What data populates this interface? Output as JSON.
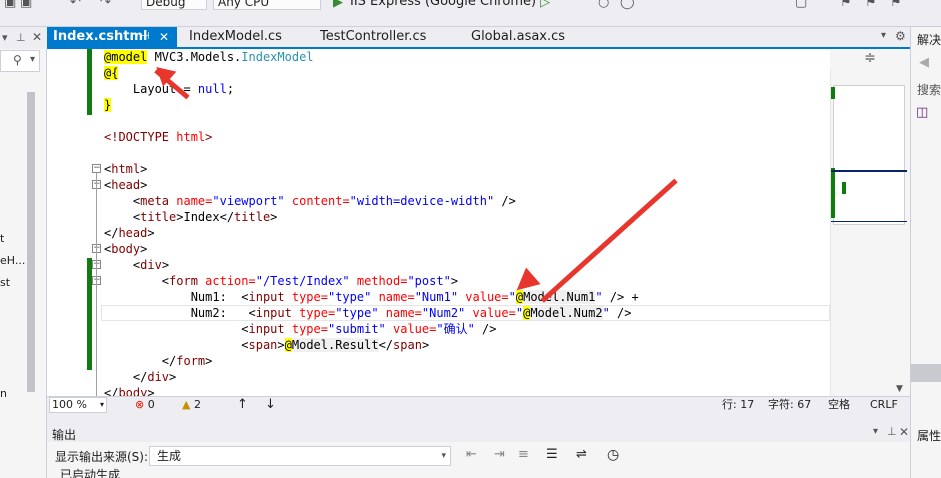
{
  "toolbar": {
    "config_value": "Debug",
    "platform_value": "Any CPU",
    "run_label": "IIS Express (Google Chrome)"
  },
  "left_panel": {
    "items": [
      "t",
      "eH...",
      "st",
      "n"
    ]
  },
  "tabs": [
    {
      "label": "Index.cshtml",
      "active": true
    },
    {
      "label": "IndexModel.cs",
      "active": false
    },
    {
      "label": "TestController.cs",
      "active": false
    },
    {
      "label": "Global.asax.cs",
      "active": false
    }
  ],
  "code": {
    "l1": {
      "a": "@model",
      "b": " MVC3.Models.",
      "c": "IndexModel"
    },
    "l2": "@{",
    "l3": {
      "a": "    Layout = ",
      "b": "null",
      "c": ";"
    },
    "l4": "}",
    "l5": {
      "a": "<!DOCTYPE ",
      "b": "html",
      "c": ">"
    },
    "l6": {
      "a": "<",
      "b": "html",
      "c": ">"
    },
    "l7": {
      "a": "<",
      "b": "head",
      "c": ">"
    },
    "l8": {
      "a": "    <",
      "b": "meta",
      "c": " name=",
      "d": "\"viewport\"",
      "e": " content=",
      "f": "\"width=device-width\"",
      "g": " />"
    },
    "l9": {
      "a": "    <",
      "b": "title",
      "c": ">Index</",
      "d": "title",
      "e": ">"
    },
    "l10": {
      "a": "</",
      "b": "head",
      "c": ">"
    },
    "l11": {
      "a": "<",
      "b": "body",
      "c": ">"
    },
    "l12": {
      "a": "    <",
      "b": "div",
      "c": ">"
    },
    "l13": {
      "a": "        <",
      "b": "form",
      "c": " action=",
      "d": "\"/Test/Index\"",
      "e": " method=",
      "f": "\"post\"",
      "g": ">"
    },
    "l14": {
      "a": "            Num1:  <",
      "b": "input",
      "c": " type=",
      "d": "\"type\"",
      "e": " name=",
      "f": "\"Num1\"",
      "g": " value=",
      "h": "\"",
      "i": "@",
      "j": "Model.Num1",
      "k": "\"",
      "l": " /> +"
    },
    "l15": {
      "a": "            Num2:   <",
      "b": "input",
      "c": " type=",
      "d": "\"type\"",
      "e": " name=",
      "f": "\"Num2\"",
      "g": " value=",
      "h": "\"",
      "i": "@",
      "j": "Model.Num2",
      "k": "\"",
      "l": " />"
    },
    "l16": {
      "a": "                   <",
      "b": "input",
      "c": " type=",
      "d": "\"submit\"",
      "e": " value=",
      "f": "\"确认\"",
      "g": " />"
    },
    "l17": {
      "a": "                   <",
      "b": "span",
      "c": ">",
      "d": "@",
      "e": "Model.Result",
      "f": "</",
      "g": "span",
      "h": ">"
    },
    "l18": {
      "a": "        </",
      "b": "form",
      "c": ">"
    },
    "l19": {
      "a": "    </",
      "b": "div",
      "c": ">"
    },
    "l20": {
      "a": "</",
      "b": "body",
      "c": ">"
    }
  },
  "status": {
    "zoom": "100 %",
    "errors": "0",
    "warnings": "2",
    "line": "行: 17",
    "col": "字符: 67",
    "spaces": "空格",
    "eol": "CRLF"
  },
  "output": {
    "title": "输出",
    "source_label": "显示输出来源(S):",
    "source_value": "生成",
    "first_line": "已启动生成"
  },
  "right_panel": {
    "title": "解决",
    "search": "搜索",
    "props": "属性"
  },
  "colors": {
    "accent": "#007ACC",
    "arrow": "#E8362D",
    "change_margin": "#107C10"
  }
}
